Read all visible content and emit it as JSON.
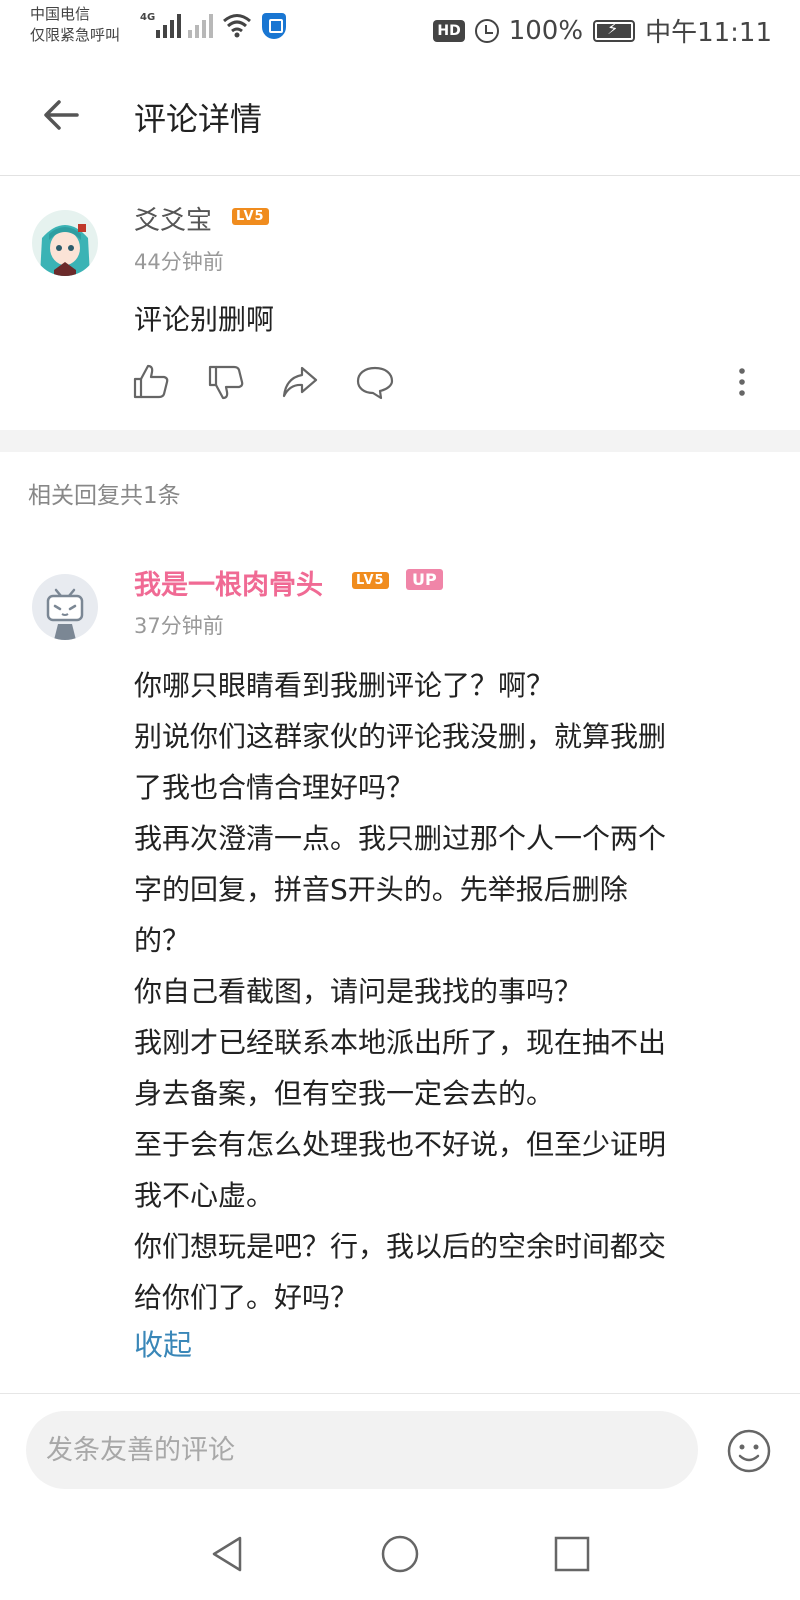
{
  "status_bar": {
    "carrier_line1": "中国电信",
    "carrier_line2": "仅限紧急呼叫",
    "network": "4G",
    "hd": "HD",
    "battery": "100%",
    "time": "中午11:11"
  },
  "header": {
    "title": "评论详情"
  },
  "main_comment": {
    "username": "爻爻宝",
    "level": "LV5",
    "time": "44分钟前",
    "text": "评论别删啊"
  },
  "replies_section": {
    "count_label": "相关回复共1条"
  },
  "reply": {
    "username": "我是一根肉骨头",
    "level": "LV5",
    "up_badge": "UP",
    "time": "37分钟前",
    "lines": [
      "你哪只眼睛看到我删评论了？啊？",
      "别说你们这群家伙的评论我没删，就算我删",
      "了我也合情合理好吗？",
      "我再次澄清一点。我只删过那个人一个两个",
      "字的回复，拼音S开头的。先举报后删除",
      "的？",
      "你自己看截图，请问是我找的事吗？",
      "我刚才已经联系本地派出所了，现在抽不出",
      "身去备案，但有空我一定会去的。",
      "至于会有怎么处理我也不好说，但至少证明",
      "我不心虚。",
      "你们想玩是吧？行，我以后的空余时间都交",
      "给你们了。好吗？"
    ],
    "collapse_label": "收起"
  },
  "input": {
    "placeholder": "发条友善的评论"
  },
  "colors": {
    "reply_name": "#f06a94",
    "level_badge": "#f08c1e",
    "up_badge": "#f085a8",
    "link": "#3a87b8"
  },
  "icons": {
    "back": "arrow-left-icon",
    "like": "thumbs-up-icon",
    "dislike": "thumbs-down-icon",
    "share": "share-icon",
    "reply": "chat-bubble-icon",
    "more": "more-vertical-icon",
    "emoji": "emoji-icon"
  }
}
